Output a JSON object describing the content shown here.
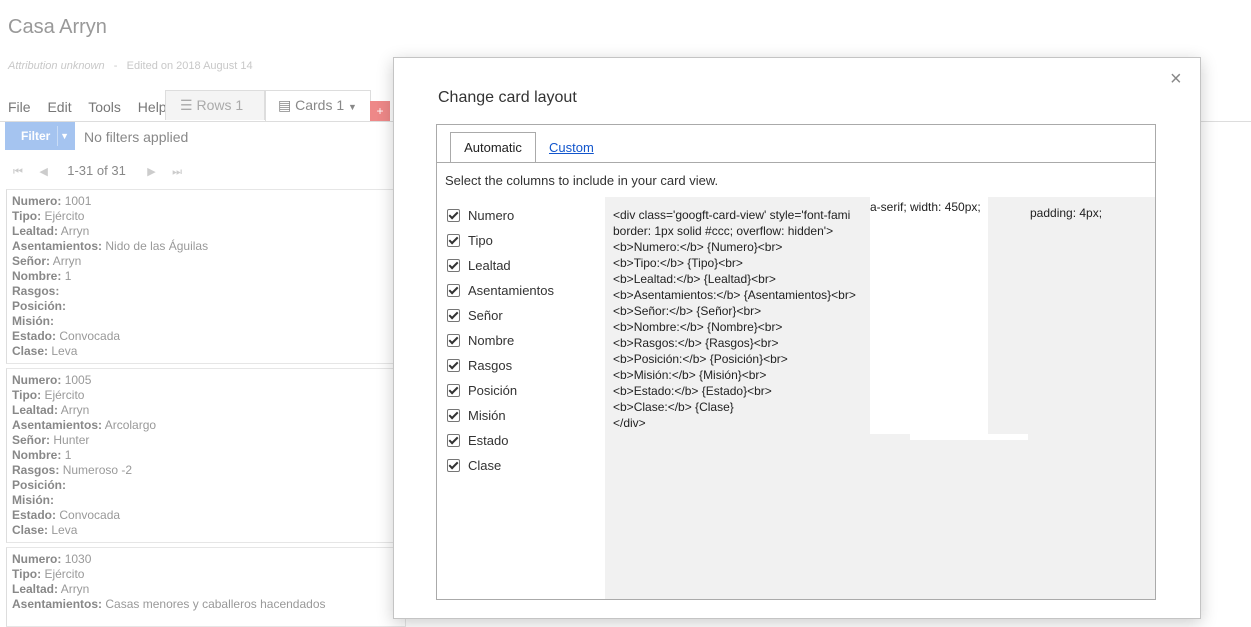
{
  "app": {
    "title": "Casa Arryn",
    "attribution": "Attribution unknown",
    "separator": "-",
    "edited": "Edited on 2018 August 14"
  },
  "menu": [
    "File",
    "Edit",
    "Tools",
    "Help"
  ],
  "view_tabs": {
    "rows_label": "Rows 1",
    "cards_label": "Cards 1",
    "plus": "+"
  },
  "filter": {
    "button_label": "Filter",
    "status": "No filters applied"
  },
  "pager": {
    "range": "1-31 of 31"
  },
  "cards": [
    {
      "rows": [
        {
          "k": "Numero:",
          "v": "1001"
        },
        {
          "k": "Tipo:",
          "v": "Ejército"
        },
        {
          "k": "Lealtad:",
          "v": "Arryn"
        },
        {
          "k": "Asentamientos:",
          "v": "Nido de las Águilas"
        },
        {
          "k": "Señor:",
          "v": "Arryn"
        },
        {
          "k": "Nombre:",
          "v": "1"
        },
        {
          "k": "Rasgos:",
          "v": ""
        },
        {
          "k": "Posición:",
          "v": ""
        },
        {
          "k": "Misión:",
          "v": ""
        },
        {
          "k": "Estado:",
          "v": "Convocada"
        },
        {
          "k": "Clase:",
          "v": "Leva"
        }
      ]
    },
    {
      "rows": [
        {
          "k": "Numero:",
          "v": "1005"
        },
        {
          "k": "Tipo:",
          "v": "Ejército"
        },
        {
          "k": "Lealtad:",
          "v": "Arryn"
        },
        {
          "k": "Asentamientos:",
          "v": "Arcolargo"
        },
        {
          "k": "Señor:",
          "v": "Hunter"
        },
        {
          "k": "Nombre:",
          "v": "1"
        },
        {
          "k": "Rasgos:",
          "v": "Numeroso -2"
        },
        {
          "k": "Posición:",
          "v": ""
        },
        {
          "k": "Misión:",
          "v": ""
        },
        {
          "k": "Estado:",
          "v": "Convocada"
        },
        {
          "k": "Clase:",
          "v": "Leva"
        }
      ]
    },
    {
      "rows": [
        {
          "k": "Numero:",
          "v": "1030"
        },
        {
          "k": "Tipo:",
          "v": "Ejército"
        },
        {
          "k": "Lealtad:",
          "v": "Arryn"
        },
        {
          "k": "Asentamientos:",
          "v": "Casas menores y caballeros hacendados"
        }
      ]
    }
  ],
  "modal": {
    "title": "Change card layout",
    "close": "×",
    "tab_automatic": "Automatic",
    "tab_custom": "Custom",
    "instructions": "Select the columns to include in your card view.",
    "columns": [
      "Numero",
      "Tipo",
      "Lealtad",
      "Asentamientos",
      "Señor",
      "Nombre",
      "Rasgos",
      "Posición",
      "Misión",
      "Estado",
      "Clase"
    ],
    "code": "<div class='googft-card-view' style='font-fami\nborder: 1px solid #ccc; overflow: hidden'>\n<b>Numero:</b> {Numero}<br>\n<b>Tipo:</b> {Tipo}<br>\n<b>Lealtad:</b> {Lealtad}<br>\n<b>Asentamientos:</b> {Asentamientos}<br>\n<b>Señor:</b> {Señor}<br>\n<b>Nombre:</b> {Nombre}<br>\n<b>Rasgos:</b> {Rasgos}<br>\n<b>Posición:</b> {Posición}<br>\n<b>Misión:</b> {Misión}<br>\n<b>Estado:</b> {Estado}<br>\n<b>Clase:</b> {Clase}\n</div>",
    "code_frag1": "a-serif; width: 450px;",
    "code_frag2": "padding: 4px;"
  }
}
